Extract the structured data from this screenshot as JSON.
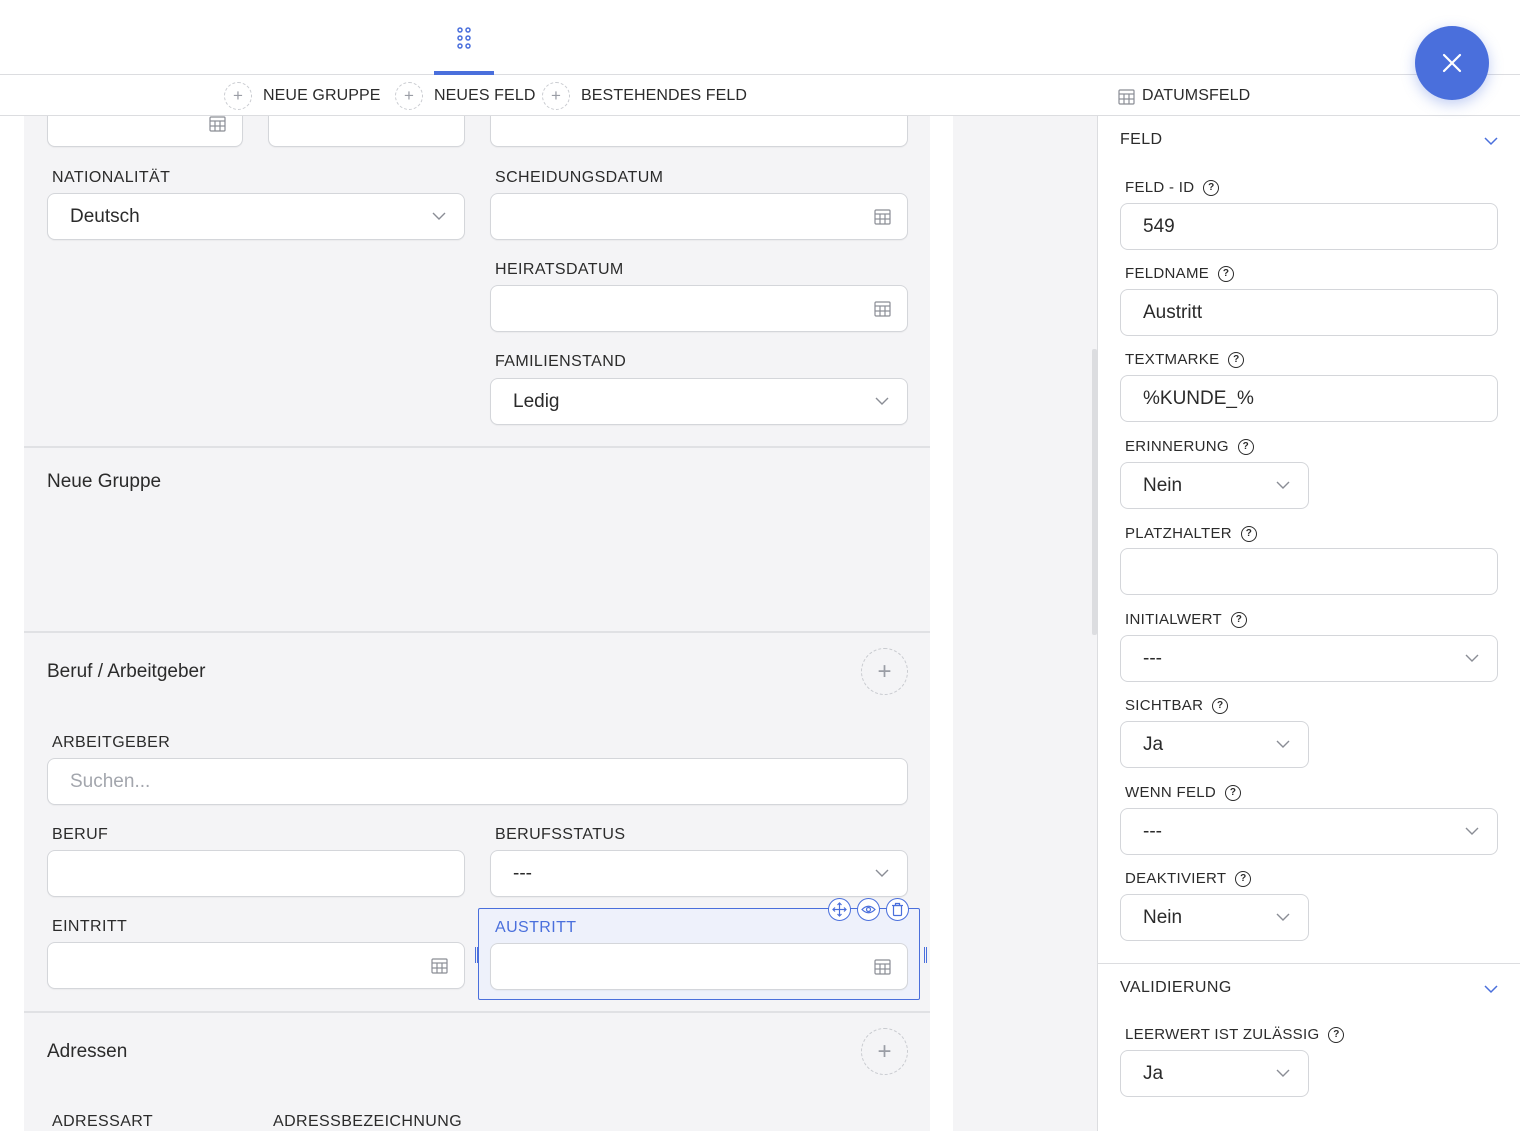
{
  "toolbar": {
    "new_group": "NEUE GRUPPE",
    "new_field": "NEUES FELD",
    "existing_field": "BESTEHENDES FELD",
    "field_type": "DATUMSFELD"
  },
  "form": {
    "nationality": {
      "label": "NATIONALITÄT",
      "value": "Deutsch"
    },
    "divorce_date": {
      "label": "SCHEIDUNGSDATUM",
      "value": ""
    },
    "marriage_date": {
      "label": "HEIRATSDATUM",
      "value": ""
    },
    "marital_status": {
      "label": "FAMILIENSTAND",
      "value": "Ledig"
    },
    "group_new": "Neue Gruppe",
    "group_job": "Beruf / Arbeitgeber",
    "employer": {
      "label": "ARBEITGEBER",
      "placeholder": "Suchen..."
    },
    "job": {
      "label": "BERUF",
      "value": ""
    },
    "job_status": {
      "label": "BERUFSSTATUS",
      "value": "---"
    },
    "entry": {
      "label": "EINTRITT",
      "value": ""
    },
    "exit": {
      "label": "AUSTRITT",
      "value": ""
    },
    "group_addresses": "Adressen",
    "address_type": {
      "label": "ADRESSART"
    },
    "address_name": {
      "label": "ADRESSBEZEICHNUNG"
    }
  },
  "panel": {
    "section_field": "FELD",
    "field_id": {
      "label": "FELD - ID",
      "value": "549"
    },
    "field_name": {
      "label": "FELDNAME",
      "value": "Austritt"
    },
    "text_mark": {
      "label": "TEXTMARKE",
      "value": "%KUNDE_%"
    },
    "reminder": {
      "label": "ERINNERUNG",
      "value": "Nein"
    },
    "placeholder": {
      "label": "PLATZHALTER",
      "value": ""
    },
    "initial_value": {
      "label": "INITIALWERT",
      "value": "---"
    },
    "visible": {
      "label": "SICHTBAR",
      "value": "Ja"
    },
    "if_field": {
      "label": "WENN FELD",
      "value": "---"
    },
    "disabled": {
      "label": "DEAKTIVIERT",
      "value": "Nein"
    },
    "section_validation": "VALIDIERUNG",
    "empty_allowed": {
      "label": "LEERWERT IST ZULÄSSIG",
      "value": "Ja"
    }
  },
  "colors": {
    "accent": "#4a6fdc",
    "canvas": "#f4f4f6",
    "border": "#d4d6da"
  },
  "icons": [
    "grid-icon",
    "close-icon",
    "plus-icon",
    "calendar-icon",
    "chevron-down-icon",
    "help-icon",
    "move-icon",
    "eye-icon",
    "trash-icon"
  ]
}
